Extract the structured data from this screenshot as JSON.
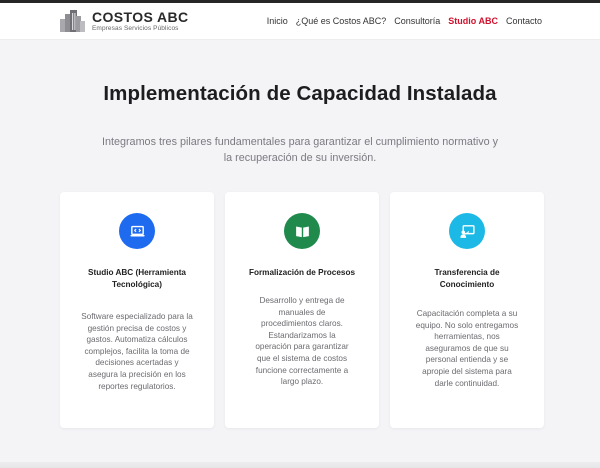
{
  "brand": {
    "name": "COSTOS ABC",
    "tagline": "Empresas Servicios Públicos"
  },
  "nav": {
    "items": [
      {
        "label": "Inicio",
        "active": false
      },
      {
        "label": "¿Qué es Costos ABC?",
        "active": false
      },
      {
        "label": "Consultoría",
        "active": false
      },
      {
        "label": "Studio ABC",
        "active": true
      },
      {
        "label": "Contacto",
        "active": false
      }
    ]
  },
  "hero": {
    "title": "Implementación de Capacidad Instalada",
    "subtitle": "Integramos tres pilares fundamentales para garantizar el cumplimiento normativo y la recuperación de su inversión."
  },
  "cards": [
    {
      "icon": "code-laptop-icon",
      "color": "#1e6bf0",
      "title": "Studio ABC (Herramienta Tecnológica)",
      "description": "Software especializado para la gestión precisa de costos y gastos. Automatiza cálculos complejos, facilita la toma de decisiones acertadas y asegura la precisión en los reportes regulatorios."
    },
    {
      "icon": "open-book-icon",
      "color": "#1f8a4c",
      "title": "Formalización de Procesos",
      "description": "Desarrollo y entrega de manuales de procedimientos claros. Estandarizamos la operación para garantizar que el sistema de costos funcione correctamente a largo plazo."
    },
    {
      "icon": "teacher-presentation-icon",
      "color": "#1cb8e6",
      "title": "Transferencia de Conocimiento",
      "description": "Capacitación completa a su equipo. No solo entregamos herramientas, nos aseguramos de que su personal entienda y se apropie del sistema para darle continuidad."
    }
  ]
}
